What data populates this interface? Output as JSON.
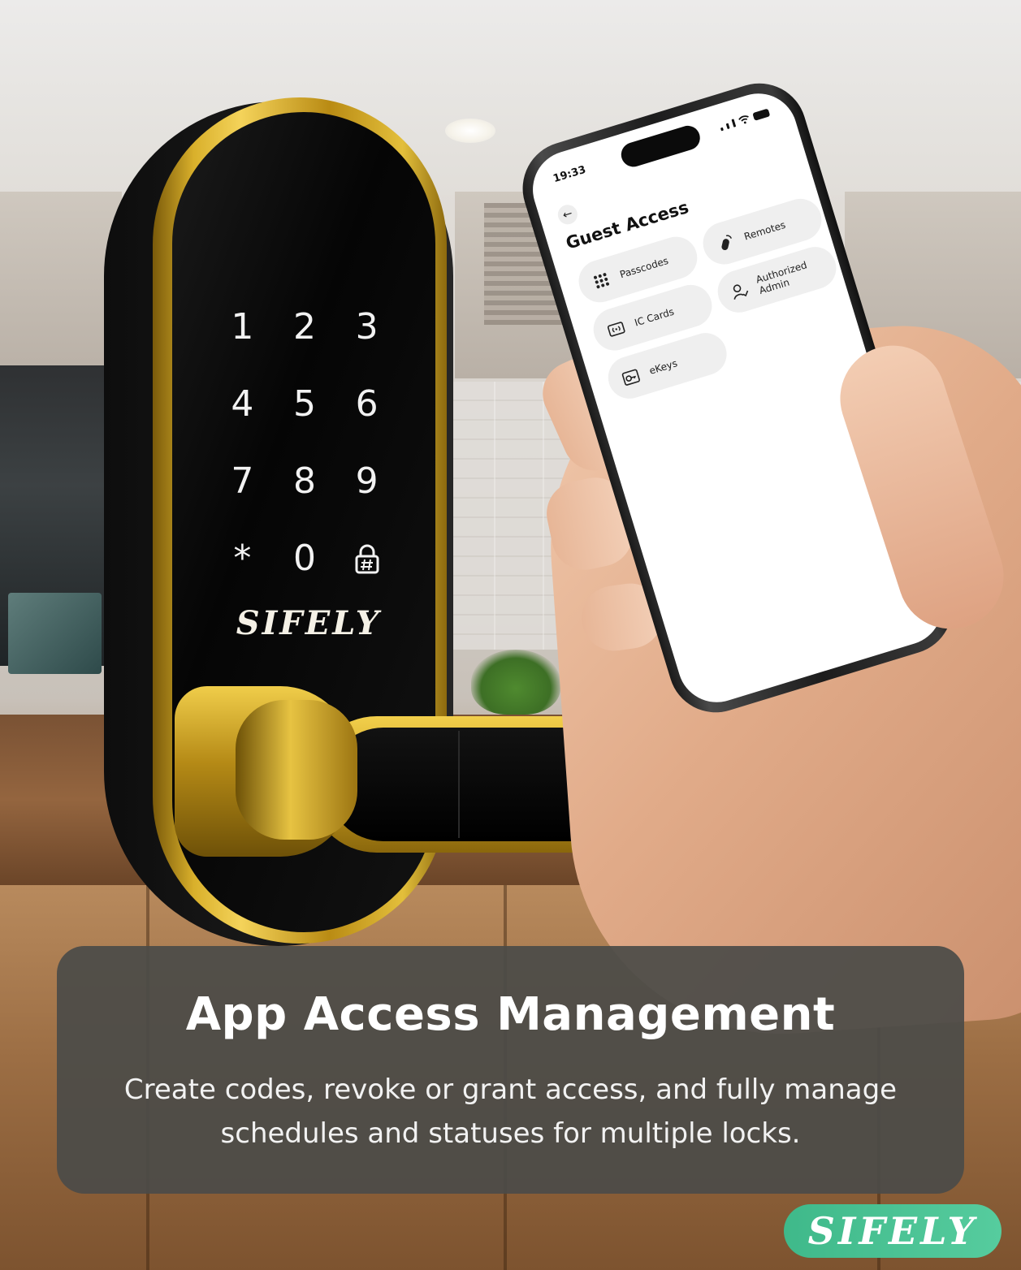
{
  "keypad": {
    "keys": [
      "1",
      "2",
      "3",
      "4",
      "5",
      "6",
      "7",
      "8",
      "9",
      "*",
      "0"
    ],
    "lock_key_icon": "lock-hash-icon"
  },
  "lock_brand": "SIFELY",
  "phone": {
    "time": "19:33",
    "back_icon": "back-arrow-icon",
    "title": "Guest Access",
    "tiles": [
      {
        "label": "Passcodes",
        "icon": "keypad-dots-icon"
      },
      {
        "label": "IC Cards",
        "icon": "rfid-card-icon"
      },
      {
        "label": "eKeys",
        "icon": "ekey-icon"
      },
      {
        "label": "Remotes",
        "icon": "remote-fob-icon"
      },
      {
        "label": "Authorized Admin",
        "icon": "admin-user-icon"
      }
    ]
  },
  "caption": {
    "title": "App Access Management",
    "text": "Create codes, revoke or grant access, and fully manage schedules and statuses for multiple locks."
  },
  "badge": {
    "brand": "SIFELY",
    "color": "#4cc395"
  }
}
